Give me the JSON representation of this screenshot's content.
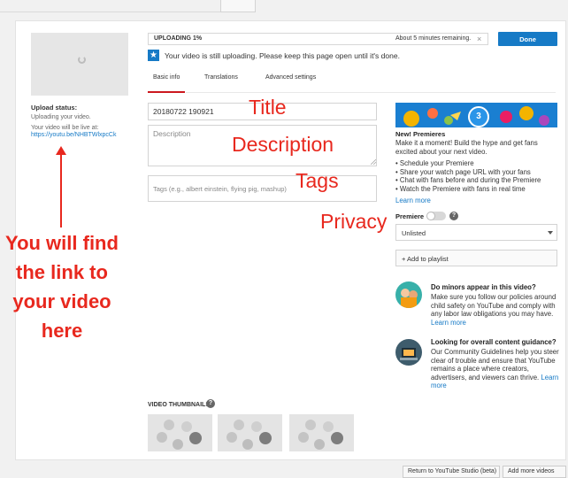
{
  "upload": {
    "status_title": "Upload status:",
    "status_text": "Uploading your video.",
    "live_text": "Your video will be live at:",
    "live_link": "https://youtu.be/NHBTWlxpcCk"
  },
  "progress": {
    "label": "UPLOADING 1%",
    "percent": 1,
    "remaining": "About 5 minutes remaining.",
    "close_glyph": "×",
    "done_label": "Done"
  },
  "notice": {
    "text": "Your video is still uploading. Please keep this page open until it's done."
  },
  "tabs": [
    {
      "label": "Basic info"
    },
    {
      "label": "Translations"
    },
    {
      "label": "Advanced settings"
    }
  ],
  "form": {
    "title_value": "20180722 190921",
    "description_placeholder": "Description",
    "tags_placeholder": "Tags (e.g., albert einstein, flying pig, mashup)"
  },
  "annotations": {
    "title": "Title",
    "description": "Description",
    "tags": "Tags",
    "privacy": "Privacy",
    "link_note": [
      "You will find",
      "the link to",
      "your video",
      "here"
    ]
  },
  "premieres": {
    "badge": "3",
    "heading": "New! Premieres",
    "text": "Make it a moment! Build the hype and get fans excited about your next video.",
    "bullets": [
      "• Schedule your Premiere",
      "• Share your watch page URL with your fans",
      "• Chat with fans before and during the Premiere",
      "• Watch the Premiere with fans in real time"
    ],
    "learn_more": "Learn more"
  },
  "settings": {
    "premiere_label": "Premiere",
    "premiere_enabled": false,
    "help_glyph": "?",
    "privacy_value": "Unlisted",
    "add_playlist": "+ Add to playlist"
  },
  "tips": [
    {
      "title": "Do minors appear in this video?",
      "body": "Make sure you follow our policies around child safety on YouTube and comply with any labor law obligations you may have.",
      "link": "Learn more"
    },
    {
      "title": "Looking for overall content guidance?",
      "body": "Our Community Guidelines help you steer clear of trouble and ensure that YouTube remains a place where creators, advertisers, and viewers can thrive.",
      "link": "Learn more"
    }
  ],
  "thumbnails": {
    "label": "VIDEO THUMBNAILS",
    "help_glyph": "?"
  },
  "footer": {
    "btn1": "Return to YouTube Studio (beta)",
    "btn2": "Add more videos"
  },
  "colors": {
    "accent": "#167ac6",
    "annotation": "#e8281e",
    "tab_active": "#cc181e"
  }
}
